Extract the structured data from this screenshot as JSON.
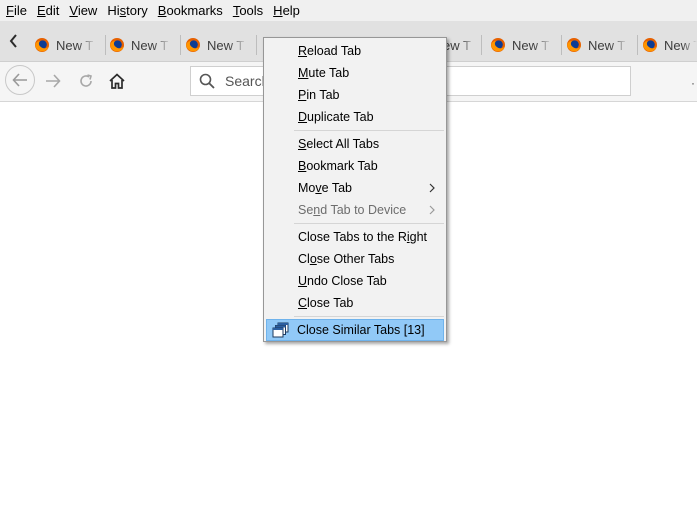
{
  "menubar": {
    "items": [
      {
        "pre": "",
        "key": "F",
        "post": "ile"
      },
      {
        "pre": "",
        "key": "E",
        "post": "dit"
      },
      {
        "pre": "",
        "key": "V",
        "post": "iew"
      },
      {
        "pre": "Hi",
        "key": "s",
        "post": "tory"
      },
      {
        "pre": "",
        "key": "B",
        "post": "ookmarks"
      },
      {
        "pre": "",
        "key": "T",
        "post": "ools"
      },
      {
        "pre": "",
        "key": "H",
        "post": "elp"
      }
    ]
  },
  "tabs": {
    "label": "New Tab",
    "visible_labels": [
      "New T",
      "New T",
      "New T",
      "ew T",
      "New T",
      "New T",
      "New T"
    ]
  },
  "navbar": {
    "search_placeholder": "Search"
  },
  "context_menu": {
    "items": [
      {
        "pre": "",
        "key": "R",
        "post": "eload Tab"
      },
      {
        "pre": "",
        "key": "M",
        "post": "ute Tab"
      },
      {
        "pre": "",
        "key": "P",
        "post": "in Tab"
      },
      {
        "pre": "",
        "key": "D",
        "post": "uplicate Tab"
      },
      {
        "pre": "",
        "key": "S",
        "post": "elect All Tabs"
      },
      {
        "pre": "",
        "key": "B",
        "post": "ookmark Tab"
      },
      {
        "pre": "Mo",
        "key": "v",
        "post": "e Tab"
      },
      {
        "pre": "Se",
        "key": "n",
        "post": "d Tab to Device"
      },
      {
        "pre": "Close Tabs to the R",
        "key": "i",
        "post": "ght"
      },
      {
        "pre": "Cl",
        "key": "o",
        "post": "se Other Tabs"
      },
      {
        "pre": "",
        "key": "U",
        "post": "ndo Close Tab"
      },
      {
        "pre": "",
        "key": "C",
        "post": "lose Tab"
      },
      {
        "pre": "",
        "key": "",
        "post": "Close Similar Tabs [13]"
      }
    ]
  },
  "icons": {
    "favicon": "firefox-icon",
    "back": "back-arrow-icon",
    "forward": "forward-arrow-icon",
    "reload": "reload-icon",
    "home": "home-icon",
    "search": "search-icon",
    "close_similar": "windows-stack-icon"
  },
  "colors": {
    "menubar_bg": "#f0f0f0",
    "tabstrip_bg": "#e1e1e1",
    "menu_bg": "#f2f2f2",
    "highlight": "#91c9f7"
  }
}
